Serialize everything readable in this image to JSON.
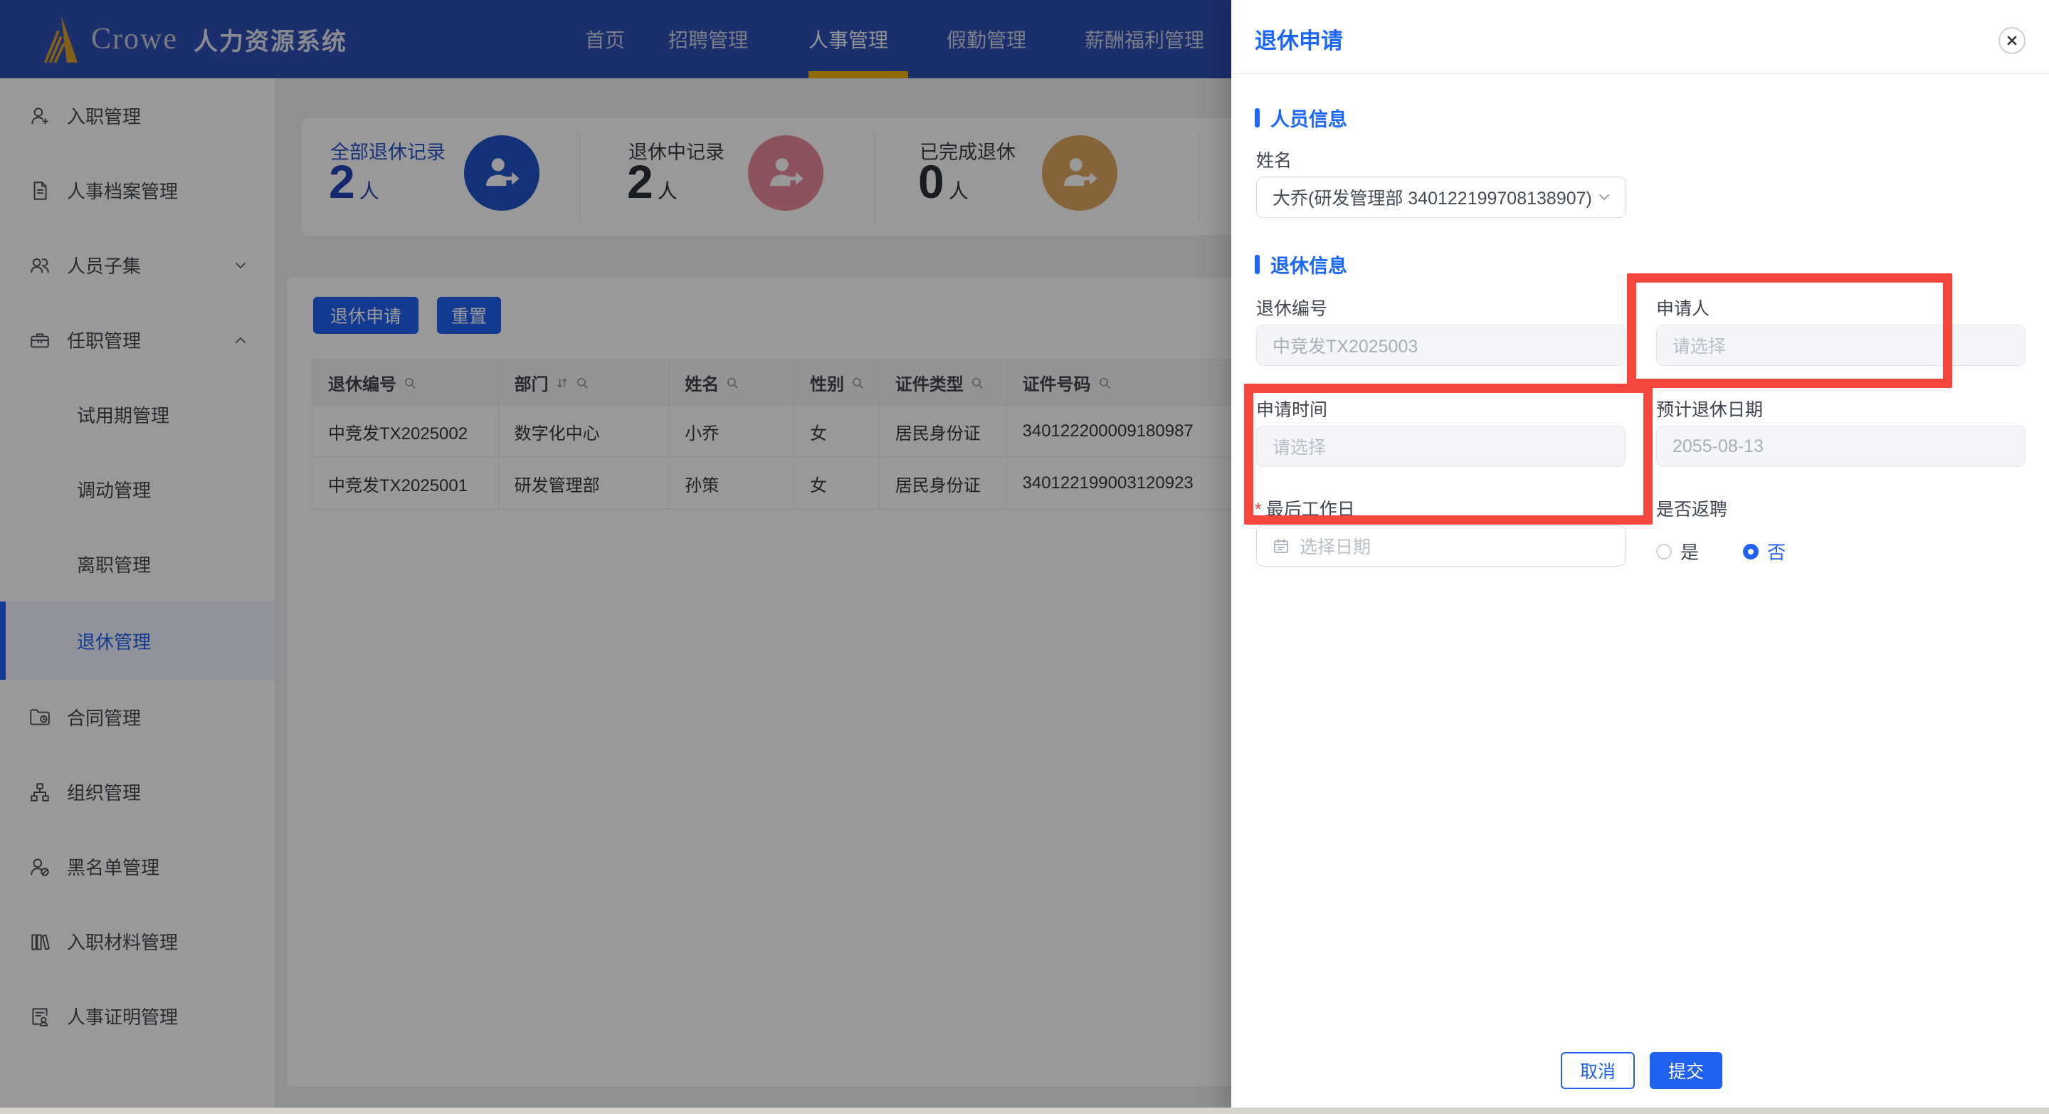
{
  "brand": {
    "logo": "crowe-triangle-icon",
    "name": "Crowe",
    "product": "人力资源系统"
  },
  "nav": {
    "items": [
      {
        "label": "首页",
        "active": false
      },
      {
        "label": "招聘管理",
        "active": false
      },
      {
        "label": "人事管理",
        "active": true
      },
      {
        "label": "假勤管理",
        "active": false
      },
      {
        "label": "薪酬福利管理",
        "active": false
      }
    ]
  },
  "sidebar": {
    "items": [
      {
        "label": "入职管理",
        "icon": "user-add-icon"
      },
      {
        "label": "人事档案管理",
        "icon": "document-icon"
      },
      {
        "label": "人员子集",
        "icon": "users-icon",
        "chevron": "down"
      },
      {
        "label": "任职管理",
        "icon": "briefcase-icon",
        "chevron": "up"
      },
      {
        "label": "试用期管理",
        "sub": true
      },
      {
        "label": "调动管理",
        "sub": true
      },
      {
        "label": "离职管理",
        "sub": true
      },
      {
        "label": "退休管理",
        "sub": true,
        "active": true
      },
      {
        "label": "合同管理",
        "icon": "contract-icon"
      },
      {
        "label": "组织管理",
        "icon": "org-chart-icon"
      },
      {
        "label": "黑名单管理",
        "icon": "blacklist-user-icon"
      },
      {
        "label": "入职材料管理",
        "icon": "materials-icon"
      },
      {
        "label": "人事证明管理",
        "icon": "certificate-icon"
      }
    ]
  },
  "stats": [
    {
      "title": "全部退休记录",
      "value": "2",
      "unit": "人",
      "circle_color": "#2154c8",
      "icon": "person-arrow-icon"
    },
    {
      "title": "退休中记录",
      "value": "2",
      "unit": "人",
      "circle_color": "#e98b9d",
      "icon": "person-arrow-icon"
    },
    {
      "title": "已完成退休",
      "value": "0",
      "unit": "人",
      "circle_color": "#dfa75f",
      "icon": "person-arrow-icon"
    }
  ],
  "toolbar": {
    "apply_label": "退休申请",
    "reset_label": "重置"
  },
  "table": {
    "headers": [
      "退休编号",
      "部门",
      "姓名",
      "性别",
      "证件类型",
      "证件号码"
    ],
    "rows": [
      [
        "中竞发TX2025002",
        "数字化中心",
        "小乔",
        "女",
        "居民身份证",
        "340122200009180987"
      ],
      [
        "中竞发TX2025001",
        "研发管理部",
        "孙策",
        "女",
        "居民身份证",
        "340122199003120923"
      ]
    ]
  },
  "drawer": {
    "title": "退休申请",
    "sections": {
      "person": "人员信息",
      "retire": "退休信息"
    },
    "fields": {
      "name": {
        "label": "姓名",
        "value": "大乔(研发管理部 340122199708138907)"
      },
      "retire_no": {
        "label": "退休编号",
        "value": "中竞发TX2025003",
        "disabled": true
      },
      "applicant": {
        "label": "申请人",
        "placeholder": "请选择",
        "disabled": true
      },
      "apply_time": {
        "label": "申请时间",
        "placeholder": "请选择",
        "disabled": true
      },
      "expected_date": {
        "label": "预计退休日期",
        "value": "2055-08-13",
        "disabled": true
      },
      "last_work_day": {
        "label": "最后工作日",
        "placeholder": "选择日期",
        "required_mark": "*"
      },
      "rehire": {
        "label": "是否返聘",
        "options": [
          "是",
          "否"
        ],
        "selected": "否"
      }
    },
    "footer": {
      "cancel_label": "取消",
      "submit_label": "提交"
    }
  },
  "annotations": {
    "highlight_color": "#f4463c",
    "highlighted_fields": [
      "申请人",
      "申请时间",
      "最后工作日"
    ]
  },
  "colors": {
    "navbar": "#2e4fb5",
    "primary": "#2061f0",
    "drawer_accent": "#1a66ff",
    "nav_active_underline": "#edb10e",
    "stat_blue": "#2154c8",
    "stat_pink": "#e98b9d",
    "stat_gold": "#dfa75f"
  }
}
